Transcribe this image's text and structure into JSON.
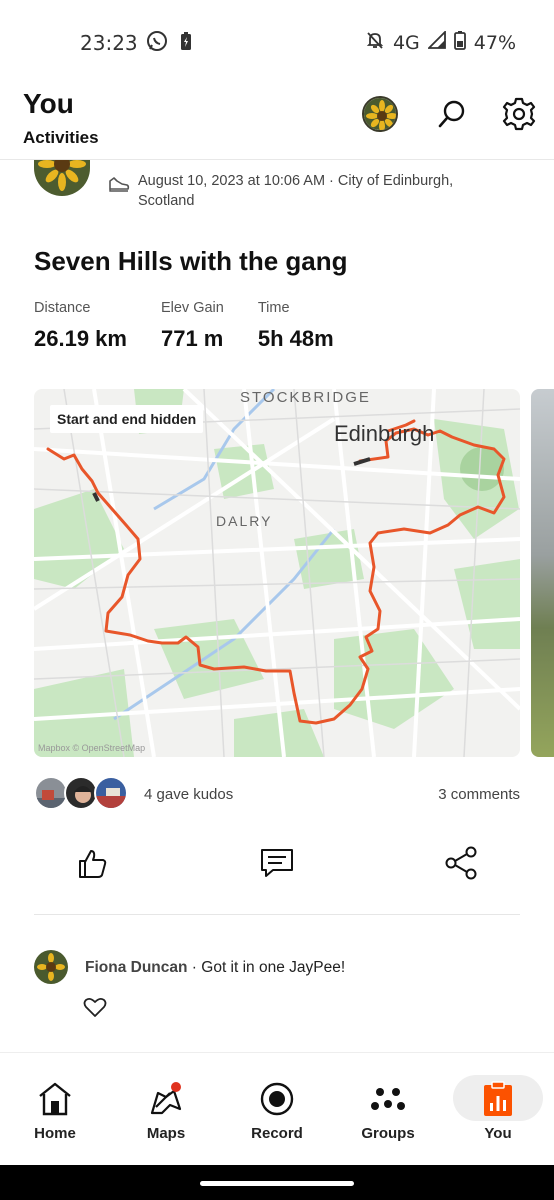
{
  "status_bar": {
    "time": "23:23",
    "network": "4G",
    "battery": "47%",
    "left_icons": [
      "whatsapp-icon",
      "battery-saver-icon"
    ],
    "right_icons": [
      "bell-off-icon",
      "signal-icon",
      "battery-icon"
    ]
  },
  "header": {
    "title": "You",
    "subtitle": "Activities",
    "icons": [
      "avatar",
      "search-icon",
      "gear-icon"
    ]
  },
  "activity": {
    "meta": "August 10, 2023 at 10:06 AM · City of Edinburgh, Scotland",
    "title": "Seven Hills with the gang",
    "stats": [
      {
        "label": "Distance",
        "value": "26.19 km"
      },
      {
        "label": "Elev Gain",
        "value": "771 m"
      },
      {
        "label": "Time",
        "value": "5h 48m"
      }
    ]
  },
  "map": {
    "badge": "Start and end hidden",
    "labels": {
      "stockbridge": "STOCKBRIDGE",
      "dalry": "DALRY",
      "city": "Edinburgh"
    },
    "attribution": "Mapbox © OpenStreetMap",
    "route_color": "#e8562a"
  },
  "social": {
    "kudos": "4 gave kudos",
    "comments": "3 comments"
  },
  "actions": [
    "thumbs-up-icon",
    "comment-icon",
    "share-icon"
  ],
  "comment": {
    "author": "Fiona Duncan",
    "separator": " · ",
    "text": "Got it in one JayPee!"
  },
  "nav": {
    "items": [
      {
        "label": "Home",
        "icon": "home-icon"
      },
      {
        "label": "Maps",
        "icon": "maps-icon"
      },
      {
        "label": "Record",
        "icon": "record-icon"
      },
      {
        "label": "Groups",
        "icon": "groups-icon"
      },
      {
        "label": "You",
        "icon": "you-icon"
      }
    ],
    "accent": "#fc5200"
  }
}
